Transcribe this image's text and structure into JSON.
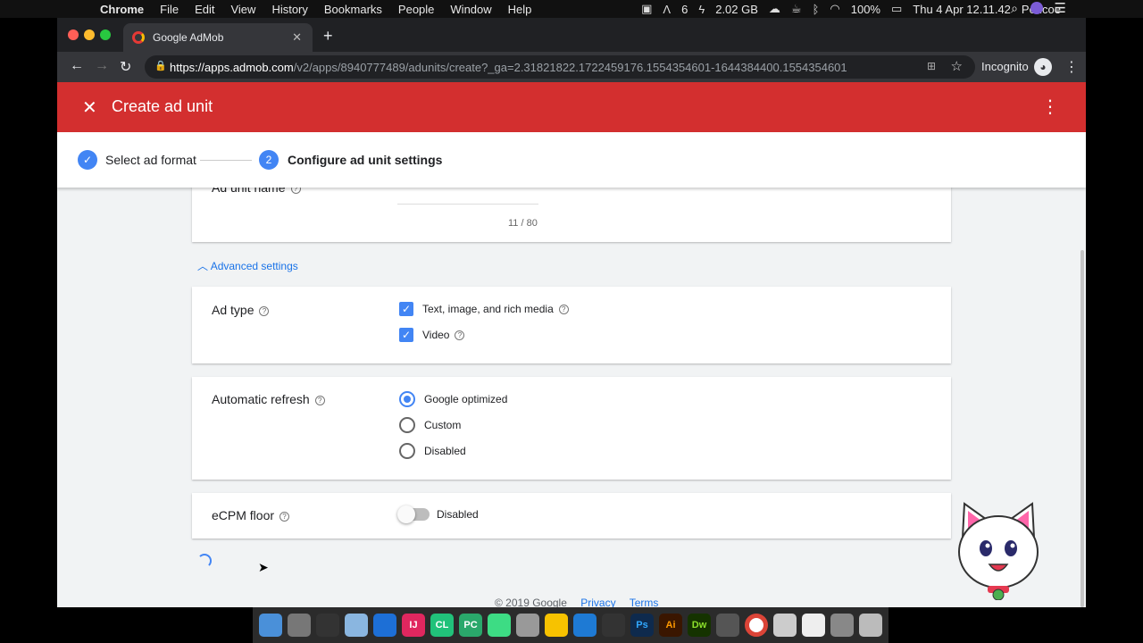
{
  "menubar": {
    "app": "Chrome",
    "menus": [
      "File",
      "Edit",
      "View",
      "History",
      "Bookmarks",
      "People",
      "Window",
      "Help"
    ],
    "notif_count": "6",
    "memory": "2.02 GB",
    "battery": "100%",
    "datetime": "Thu 4 Apr  12.11.42",
    "user": "Poncoe"
  },
  "browser": {
    "tab_title": "Google AdMob",
    "url_host": "https://apps.admob.com",
    "url_path": "/v2/apps/8940777489/adunits/create?_ga=2.31821822.1722459176.1554354601-1644384400.1554354601",
    "incognito_label": "Incognito"
  },
  "header": {
    "title": "Create ad unit"
  },
  "stepper": {
    "step1_label": "Select ad format",
    "step2_number": "2",
    "step2_label": "Configure ad unit settings"
  },
  "ad_unit_name": {
    "label": "Ad unit name",
    "counter": "11 / 80"
  },
  "advanced_settings": "Advanced settings",
  "ad_type": {
    "label": "Ad type",
    "options": [
      {
        "label": "Text, image, and rich media",
        "checked": true
      },
      {
        "label": "Video",
        "checked": true
      }
    ]
  },
  "automatic_refresh": {
    "label": "Automatic refresh",
    "options": [
      {
        "label": "Google optimized",
        "selected": true
      },
      {
        "label": "Custom",
        "selected": false
      },
      {
        "label": "Disabled",
        "selected": false
      }
    ]
  },
  "ecpm_floor": {
    "label": "eCPM floor",
    "toggle_label": "Disabled",
    "enabled": false
  },
  "footer": {
    "copyright": "© 2019 Google",
    "privacy": "Privacy",
    "terms": "Terms"
  },
  "colors": {
    "header": "#d32f2f",
    "accent": "#4285f4",
    "link": "#1a73e8"
  },
  "dock_icons": [
    "finder-icon",
    "launchpad-icon",
    "final-cut-icon",
    "box-icon",
    "trello-icon",
    "intellij-icon",
    "clion-icon",
    "pycharm-icon",
    "android-studio-icon",
    "database-icon",
    "cyberduck-icon",
    "vscode-icon",
    "figma-icon",
    "photoshop-icon",
    "illustrator-icon",
    "dreamweaver-icon",
    "davinci-icon",
    "chrome-icon",
    "preview-icon",
    "keyboard-icon",
    "utility-icon",
    "trash-icon"
  ]
}
